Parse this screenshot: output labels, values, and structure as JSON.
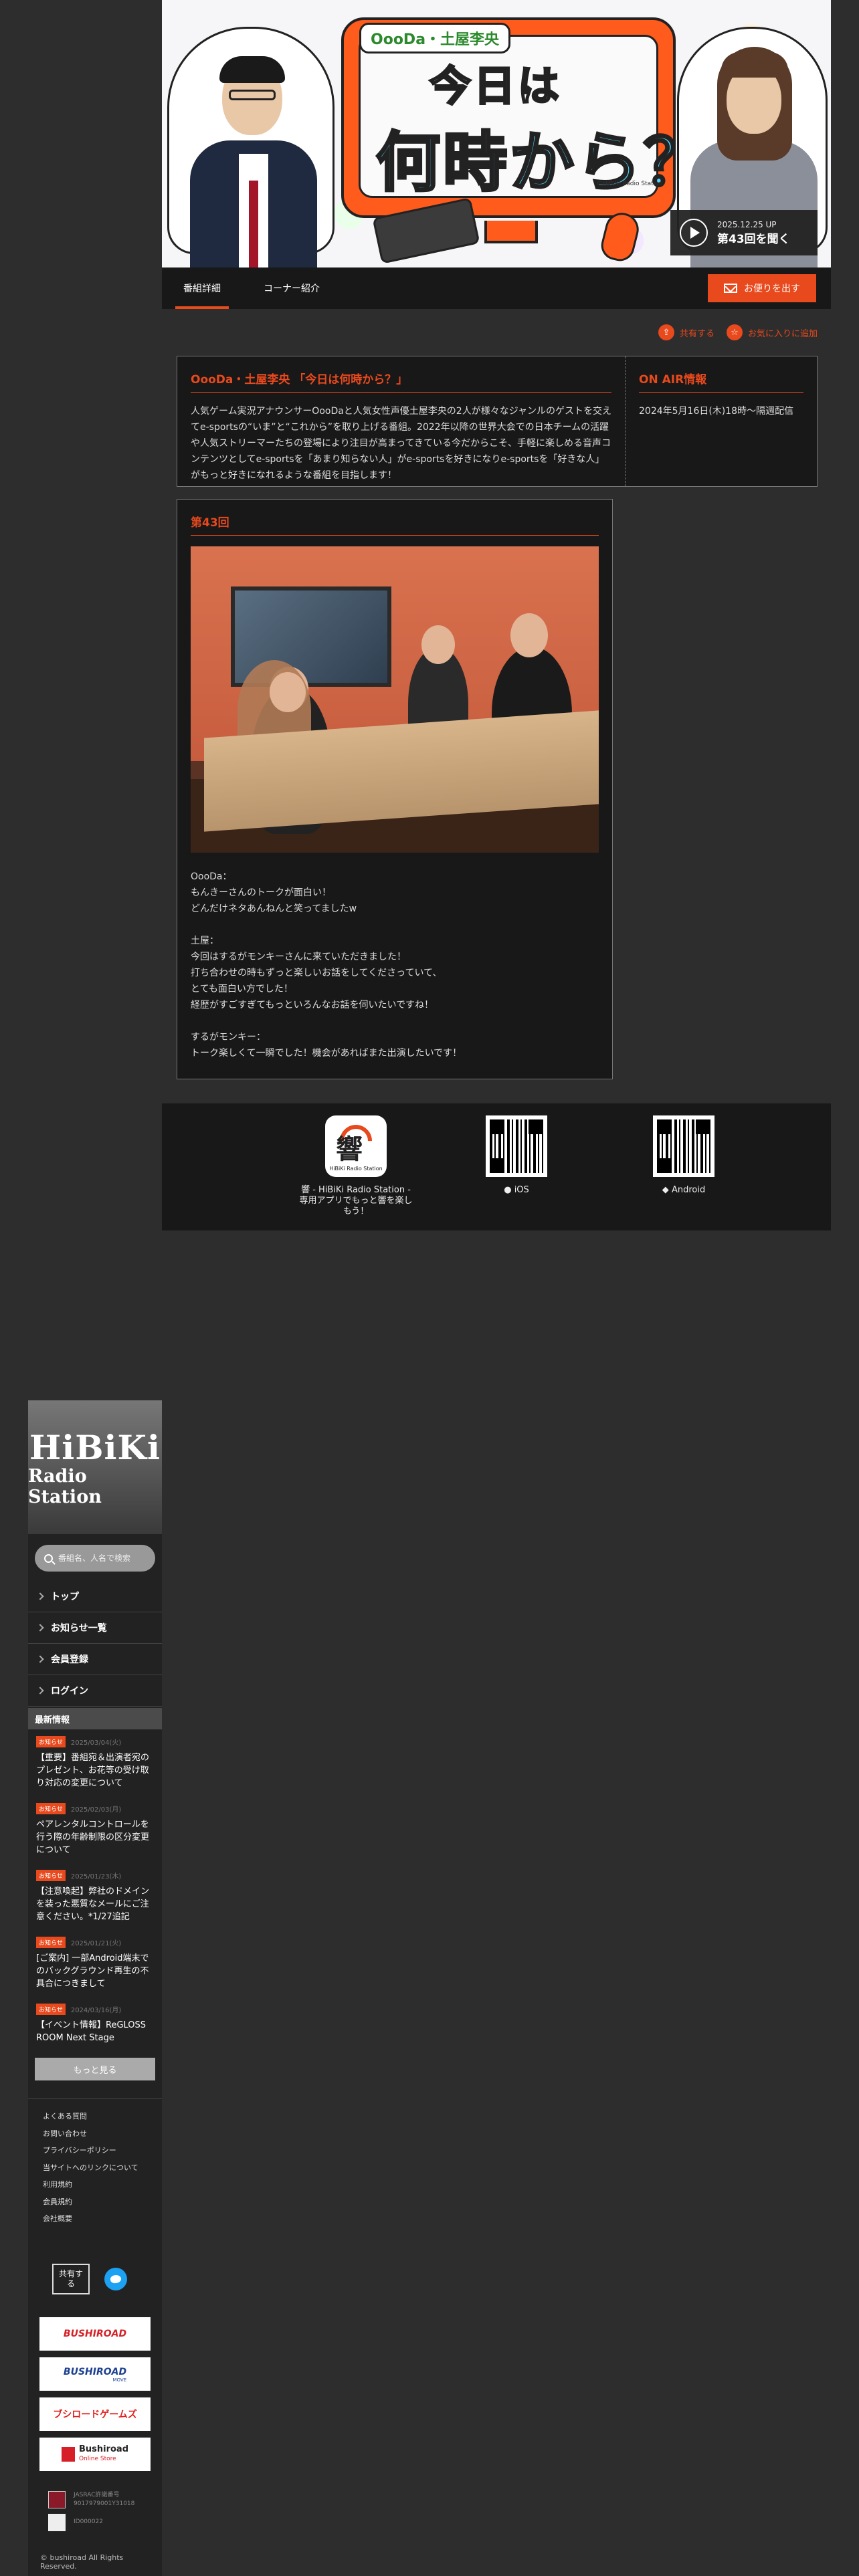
{
  "hero": {
    "tag": "OooDa・土屋李央",
    "title_line1": "今日は",
    "title_line2": "何時から？",
    "credit": "©HiBiKi Radio Station",
    "listen_date": "2025.12.25 UP",
    "listen_label": "第43回を聞く"
  },
  "tabs": [
    {
      "label": "番組詳細"
    },
    {
      "label": "コーナー紹介"
    }
  ],
  "mail_button": "お便りを出す",
  "actions": {
    "share": "共有する",
    "favorite": "お気に入りに追加"
  },
  "program": {
    "title": "OooDa・土屋李央 「今日は何時から？」",
    "description": "人気ゲーム実況アナウンサーOooDaと人気女性声優土屋李央の2人が様々なジャンルのゲストを交えてe-sportsの“いま”と“これから”を取り上げる番組。2022年以降の世界大会での日本チームの活躍や人気ストリーマーたちの登場により注目が高まってきている今だからこそ、手軽に楽しめる音声コンテンツとしてe-sportsを「あまり知らない人」がe-sportsを好きになりe-sportsを「好きな人」がもっと好きになれるような番組を目指します！"
  },
  "onair": {
    "title": "ON AIR情報",
    "text": "2024年5月16日(木)18時〜隔週配信"
  },
  "episode": {
    "title": "第43回",
    "paragraphs": [
      "OooDa：\nもんきーさんのトークが面白い！\nどんだけネタあんねんと笑ってましたw",
      "土屋：\n今回はするがモンキーさんに来ていただきました！\n打ち合わせの時もずっと楽しいお話をしてくださっていて、\nとても面白い方でした！\n経歴がすごすぎてもっといろんなお話を伺いたいですね！",
      "するがモンキー：\nトーク楽しくて一瞬でした！機会があればまた出演したいです！"
    ]
  },
  "app_banner": {
    "logo_kanji": "響",
    "logo_brand": "HiBiKi Radio Station",
    "caption": "響 - HiBiKi Radio Station - 専用アプリでもっと響を楽しもう！",
    "ios": "iOS",
    "android": "Android"
  },
  "sidebar": {
    "logo_line1": "HiBiKi",
    "logo_line2": "Radio Station",
    "search_placeholder": "番組名、人名で検索",
    "nav": [
      {
        "label": "トップ"
      },
      {
        "label": "お知らせ一覧"
      },
      {
        "label": "会員登録"
      },
      {
        "label": "ログイン"
      }
    ],
    "news_heading": "最新情報",
    "news": [
      {
        "badge": "お知らせ",
        "date": "2025/03/04(火)",
        "title": "【重要】番組宛＆出演者宛のプレゼント、お花等の受け取り対応の変更について"
      },
      {
        "badge": "お知らせ",
        "date": "2025/02/03(月)",
        "title": "ペアレンタルコントロールを行う際の年齢制限の区分変更について"
      },
      {
        "badge": "お知らせ",
        "date": "2025/01/23(木)",
        "title": "【注意喚起】弊社のドメインを装った悪質なメールにご注意ください。*1/27追記"
      },
      {
        "badge": "お知らせ",
        "date": "2025/01/21(火)",
        "title": "[ご案内] 一部Android端末でのバックグラウンド再生の不具合につきまして"
      },
      {
        "badge": "お知らせ",
        "date": "2024/03/16(月)",
        "title": "【イベント情報】ReGLOSS ROOM Next Stage"
      }
    ],
    "more": "もっと見る",
    "footer_links": [
      "よくある質問",
      "お問い合わせ",
      "プライバシーポリシー",
      "当サイトへのリンクについて",
      "利用規約",
      "会員規約",
      "会社概要"
    ],
    "share": "共有する",
    "brands": {
      "b1": "BUSHIROAD",
      "b2": "BUSHIROAD",
      "b2_sub": "MOVE",
      "b3": "ブシロードゲームズ",
      "b4": "Bushiroad",
      "b4_sub": "Online Store"
    },
    "jasrac_text": "JASRAC許諾番号\n9017979001Y31018",
    "nexx_text": "ID000022",
    "copyright": "© bushiroad All Rights Reserved."
  }
}
